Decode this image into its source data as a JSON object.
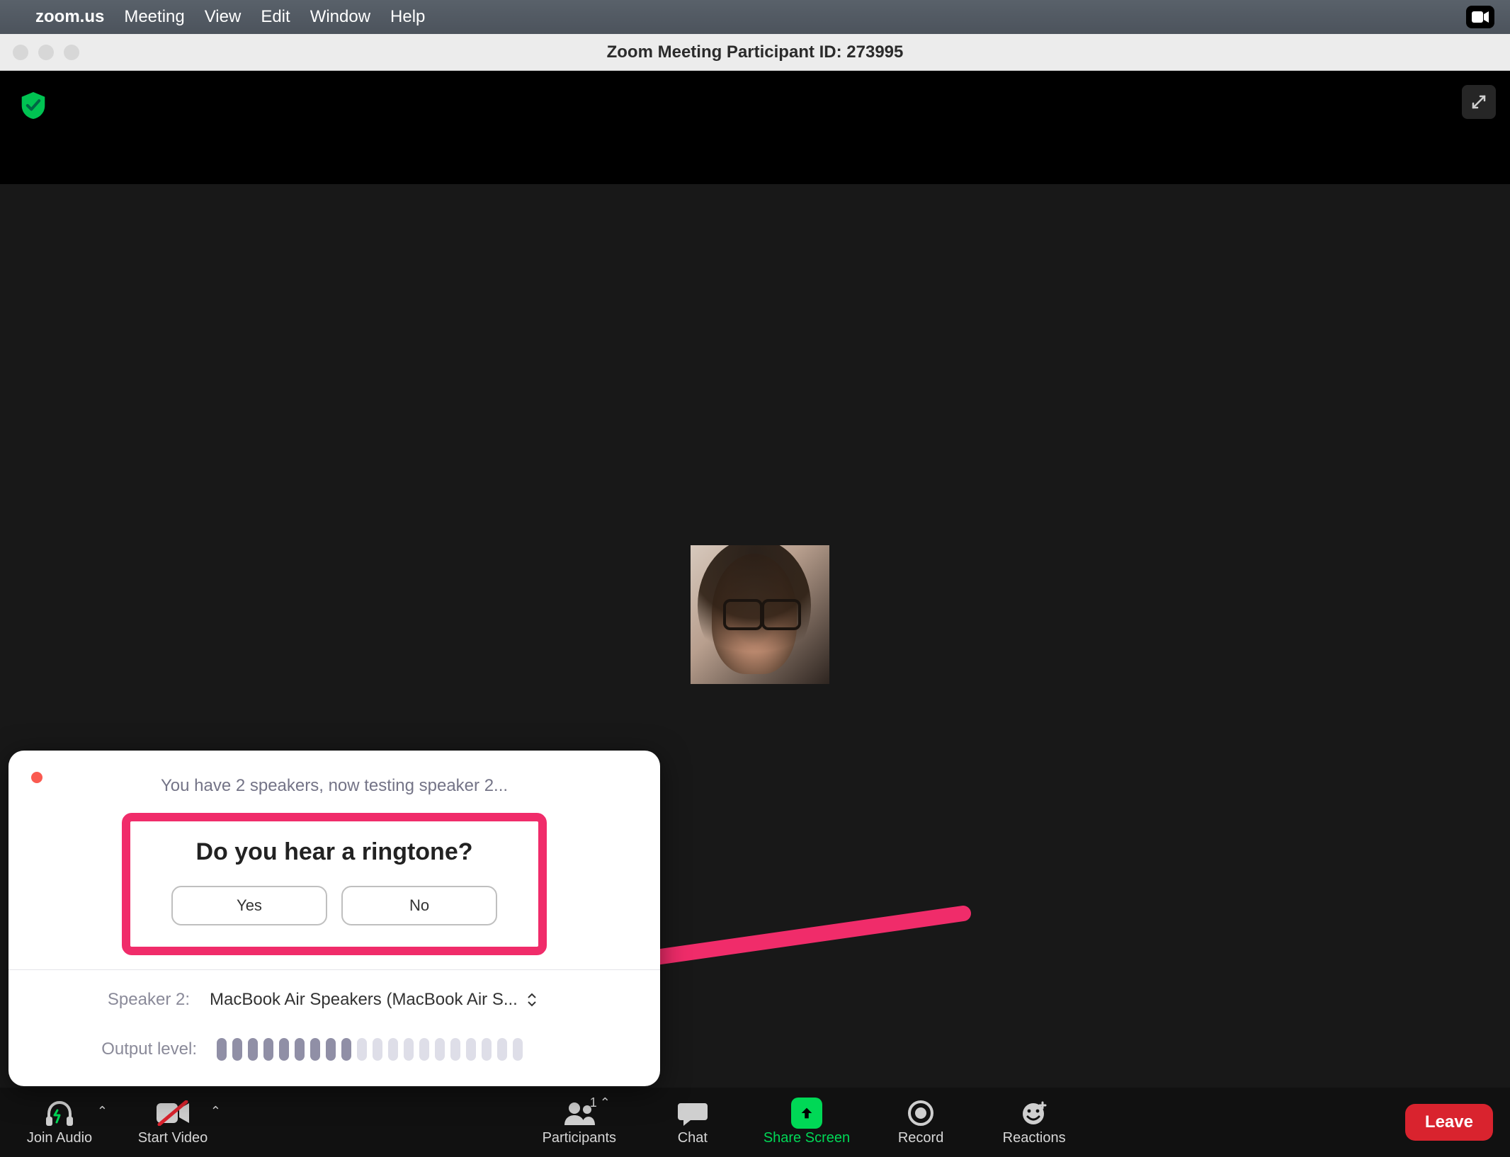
{
  "menubar": {
    "app": "zoom.us",
    "items": [
      "Meeting",
      "View",
      "Edit",
      "Window",
      "Help"
    ]
  },
  "window": {
    "title": "Zoom Meeting Participant ID: 273995"
  },
  "dialog": {
    "subtitle": "You have 2 speakers, now testing speaker 2...",
    "question": "Do you hear a ringtone?",
    "yes": "Yes",
    "no": "No",
    "speaker_label": "Speaker 2:",
    "speaker_value": "MacBook Air Speakers (MacBook Air S...",
    "output_label": "Output level:",
    "level_on_count": 9,
    "level_total": 20
  },
  "toolbar": {
    "join_audio": "Join Audio",
    "start_video": "Start Video",
    "participants": "Participants",
    "participants_count": "1",
    "chat": "Chat",
    "share_screen": "Share Screen",
    "record": "Record",
    "reactions": "Reactions",
    "leave": "Leave"
  },
  "colors": {
    "highlight": "#f02c6a",
    "share_green": "#00d856",
    "leave_red": "#d9232e"
  }
}
